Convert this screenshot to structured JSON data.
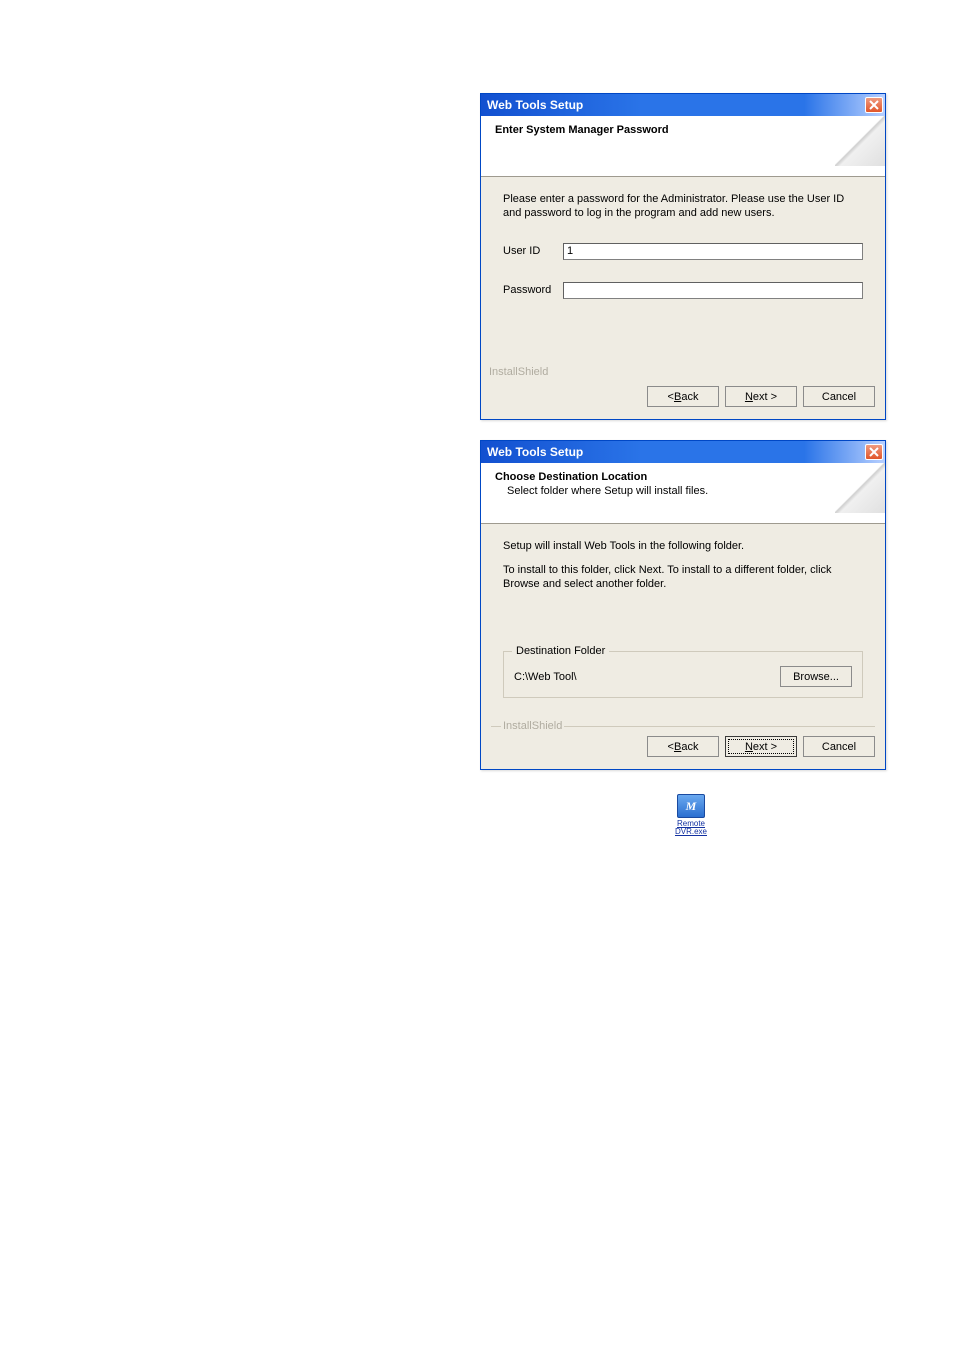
{
  "dialog1": {
    "title": "Web Tools Setup",
    "header_title": "Enter System Manager Password",
    "instruction": "Please enter a password for the Administrator. Please use the User ID and password to log in the program and add new users.",
    "userid_label": "User ID",
    "userid_value": "1",
    "password_label": "Password",
    "password_value": "",
    "installshield": "InstallShield",
    "back_prefix": "< ",
    "back_u": "B",
    "back_rest": "ack",
    "next_u": "N",
    "next_rest": "ext >",
    "cancel": "Cancel"
  },
  "dialog2": {
    "title": "Web Tools Setup",
    "header_title": "Choose Destination Location",
    "header_sub": "Select folder where Setup will install files.",
    "line1": "Setup will install Web Tools in the following folder.",
    "line2": "To install to this folder, click Next. To install to a different folder, click Browse and select another folder.",
    "dest_folder_label": "Destination Folder",
    "dest_path": "C:\\Web Tool\\",
    "browse_u": "r",
    "browse_prefix": "B",
    "browse_rest": "owse...",
    "installshield": "InstallShield",
    "back_prefix": "< ",
    "back_u": "B",
    "back_rest": "ack",
    "next_u": "N",
    "next_rest": "ext >",
    "cancel": "Cancel"
  },
  "desktop_icon": {
    "glyph": "M",
    "label_line1": "Remote",
    "label_line2": "DVR.exe"
  }
}
